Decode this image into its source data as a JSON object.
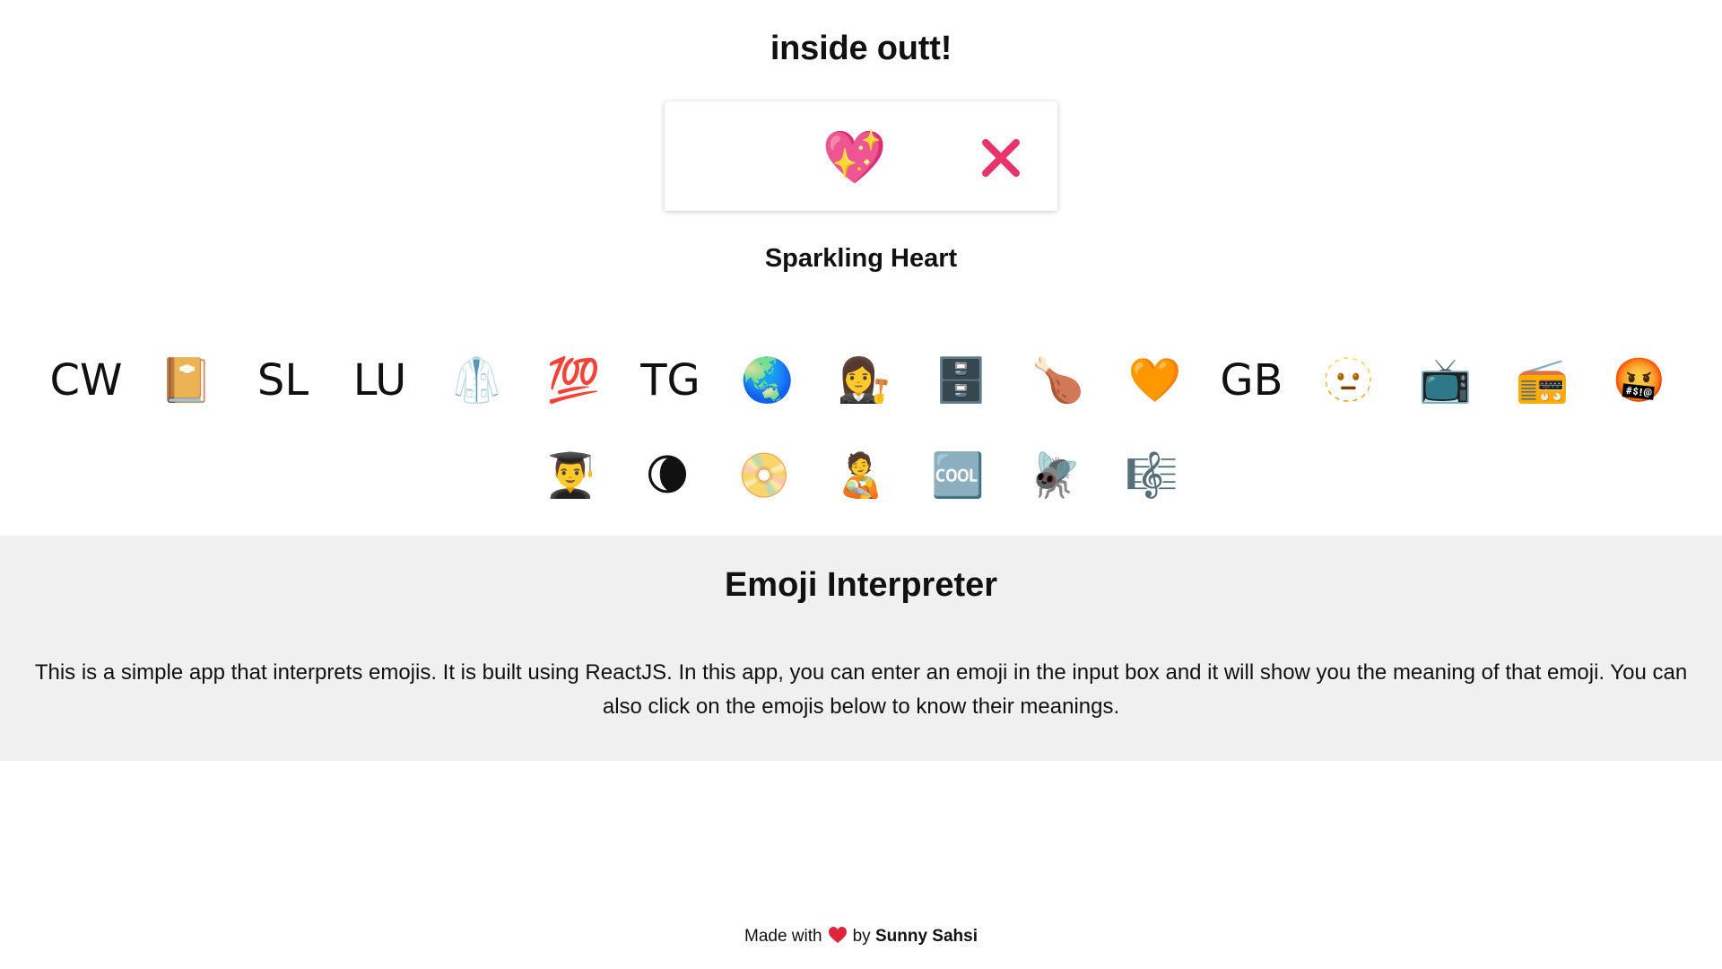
{
  "header": {
    "title": "inside outt!"
  },
  "input": {
    "value": "💖",
    "clear_icon": "close-icon",
    "accent_color": "#e8336b"
  },
  "result": {
    "meaning": "Sparkling Heart"
  },
  "emoji_list": {
    "items": [
      "CW",
      "📔",
      "SL",
      "LU",
      "🥼",
      "💯",
      "TG",
      "🌏",
      "👩‍⚖️",
      "🗄️",
      "🍗",
      "🧡",
      "GB",
      "🫥",
      "📺",
      "📻",
      "🤬",
      "👨‍🎓",
      "🌘",
      "📀",
      "🧑‍🍼",
      "🆒",
      "🪰",
      "🎼"
    ]
  },
  "about": {
    "title": "Emoji Interpreter",
    "description": "This is a simple app that interprets emojis. It is built using ReactJS. In this app, you can enter an emoji in the input box and it will show you the meaning of that emoji. You can also click on the emojis below to know their meanings."
  },
  "footer": {
    "made_with": "Made with",
    "heart_icon": "heart-icon",
    "heart_color": "#e0243a",
    "by": "by",
    "author": "Sunny Sahsi"
  },
  "colors": {
    "about_background": "#f0f0f0",
    "page_background": "#ffffff"
  }
}
